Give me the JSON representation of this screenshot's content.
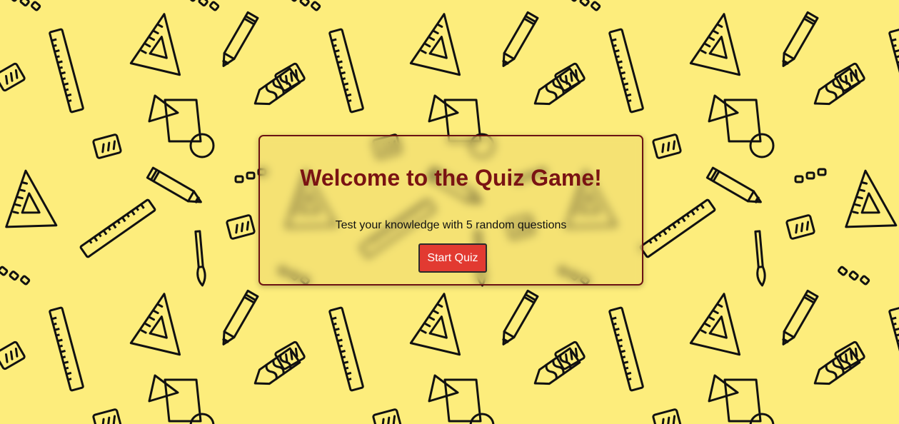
{
  "background": {
    "color": "#fded7c",
    "pattern_icons": [
      "triangle-ruler-icon",
      "pencil-icon",
      "ruler-icon",
      "crayon-icon",
      "eraser-icon",
      "paintbrush-icon",
      "shapes-icon"
    ]
  },
  "quiz": {
    "title": "Welcome to the Quiz Game!",
    "subtitle": "Test your knowledge with 5 random questions",
    "start_label": "Start Quiz",
    "accent_color": "#7a1313",
    "button_color": "#e23a31"
  }
}
